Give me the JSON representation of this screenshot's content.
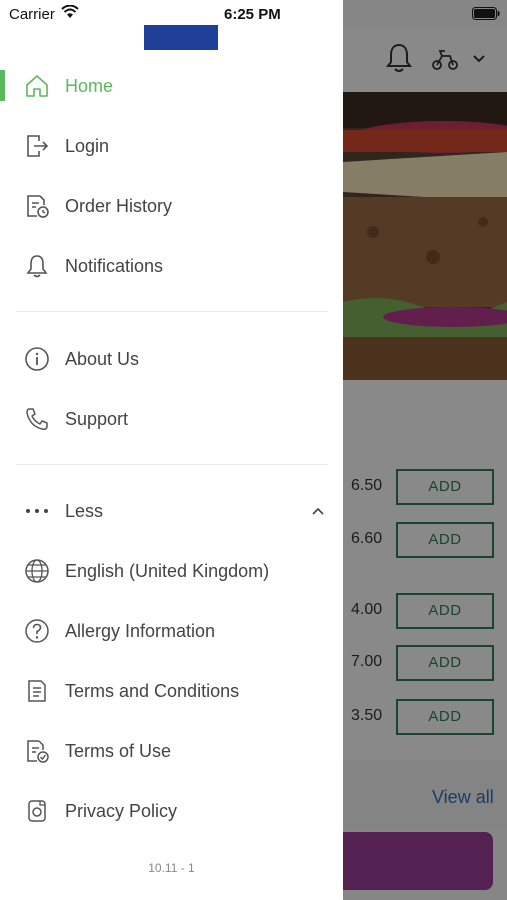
{
  "status_bar": {
    "carrier": "Carrier",
    "time": "6:25 PM"
  },
  "drawer": {
    "logo": "brand-logo",
    "primary_items": [
      {
        "label": "Home",
        "icon": "home-icon",
        "active": true
      },
      {
        "label": "Login",
        "icon": "login-icon"
      },
      {
        "label": "Order History",
        "icon": "order-history-icon"
      },
      {
        "label": "Notifications",
        "icon": "bell-icon"
      }
    ],
    "secondary_items": [
      {
        "label": "About Us",
        "icon": "info-icon"
      },
      {
        "label": "Support",
        "icon": "phone-icon"
      }
    ],
    "more_toggle": {
      "label": "Less",
      "icon": "more-dots-icon"
    },
    "extra_items": [
      {
        "label": "English (United Kingdom)",
        "icon": "globe-icon"
      },
      {
        "label": "Allergy Information",
        "icon": "question-icon"
      },
      {
        "label": "Terms and Conditions",
        "icon": "document-icon"
      },
      {
        "label": "Terms of Use",
        "icon": "document-check-icon"
      },
      {
        "label": "Privacy Policy",
        "icon": "privacy-icon"
      }
    ],
    "version": "10.11 - 1"
  },
  "background": {
    "prices": [
      "6.50",
      "6.60",
      "4.00",
      "7.00",
      "3.50"
    ],
    "add_label": "ADD",
    "view_all": "View all"
  },
  "colors": {
    "accent": "#5cb85c",
    "add_border": "#2e7d5b",
    "link": "#2a72b8",
    "cta": "#9a3e96",
    "logo": "#1f3f99"
  }
}
